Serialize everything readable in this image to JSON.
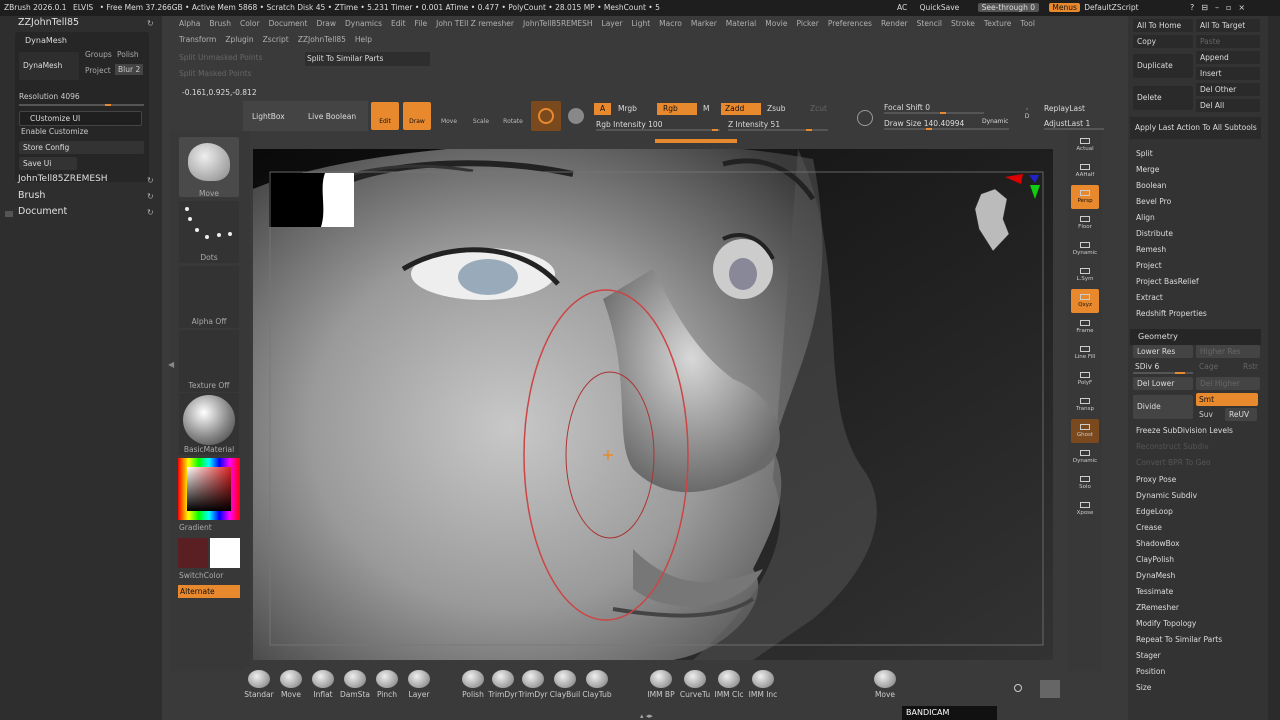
{
  "titlebar": {
    "app": "ZBrush 2026.0.1",
    "user": "ELVIS",
    "stats": "• Free Mem 37.266GB • Active Mem 5868 • Scratch Disk 45 • ZTime • 5.231 Timer • 0.001 ATime • 0.477 • PolyCount • 28.015 MP • MeshCount • 5",
    "ac": "AC",
    "quicksave": "QuickSave",
    "seethrough": "See-through",
    "seethrough_val": "0",
    "menus": "Menus",
    "script": "DefaultZScript"
  },
  "menubar": {
    "row1": [
      "Alpha",
      "Brush",
      "Color",
      "Document",
      "Draw",
      "Dynamics",
      "Edit",
      "File",
      "John TEll Z remesher",
      "JohnTell85REMESH",
      "Layer",
      "Light",
      "Macro",
      "Marker",
      "Material",
      "Movie",
      "Picker",
      "Preferences",
      "Render",
      "Stencil",
      "Stroke",
      "Texture",
      "Tool"
    ],
    "row2": [
      "Transform",
      "Zplugin",
      "Zscript",
      "ZZJohnTell85",
      "Help"
    ]
  },
  "left_panel": {
    "title": "ZZJohnTell85",
    "dynamesh_header": "DynaMesh",
    "dynamesh": "DynaMesh",
    "groups": "Groups",
    "polish": "Polish",
    "project": "Project",
    "blur": "Blur 2",
    "resolution": "Resolution 4096",
    "customize_ui": "CUstomize UI",
    "enable_customize": "Enable Customize",
    "store_config": "Store Config",
    "save_ui": "Save Ui",
    "menu_items": [
      "JohnTell85ZREMESH",
      "Brush",
      "Document"
    ]
  },
  "toolbar": {
    "split_unmasked": "Split Unmasked Points",
    "split_masked": "Split Masked Points",
    "split_similar": "Split To Similar Parts",
    "coords": "-0.161,0.925,-0.812",
    "lightbox": "LightBox",
    "live_boolean": "Live Boolean",
    "edit": "Edit",
    "draw": "Draw",
    "move": "Move",
    "scale": "Scale",
    "rotate": "Rotate",
    "a": "A",
    "mrgb": "Mrgb",
    "rgb": "Rgb",
    "m": "M",
    "zadd": "Zadd",
    "zsub": "Zsub",
    "zcut": "Zcut",
    "rgb_intensity": "Rgb Intensity 100",
    "z_intensity": "Z Intensity 51",
    "focal_shift": "Focal Shift 0",
    "draw_size": "Draw Size 140.40994",
    "dynamic": "Dynamic",
    "replay_last": "ReplayLast",
    "adjust_last": "AdjustLast 1"
  },
  "left_shelf": [
    {
      "label": "Move"
    },
    {
      "label": "Dots"
    },
    {
      "label": "Alpha Off"
    },
    {
      "label": "Texture Off"
    },
    {
      "label": "BasicMaterial"
    },
    {
      "label": "Gradient"
    },
    {
      "label": "SwitchColor"
    },
    {
      "label": "Alternate"
    }
  ],
  "right_shelf": [
    "Actual",
    "AAHalf",
    "Persp",
    "Floor",
    "Dynamic",
    "L.Sym",
    "Qxyz",
    "Frame",
    "Line Fill",
    "PolyF",
    "Transp",
    "Ghost",
    "Dynamic",
    "Solo",
    "Xpose"
  ],
  "right_panel": {
    "all_to_home": "All To Home",
    "all_to_target": "All To Target",
    "copy": "Copy",
    "paste": "Paste",
    "duplicate": "Duplicate",
    "append": "Append",
    "insert": "Insert",
    "delete": "Delete",
    "del_other": "Del Other",
    "del_all": "Del All",
    "apply_last": "Apply Last Action To All Subtools",
    "subtool_actions": [
      "Split",
      "Merge",
      "Boolean",
      "Bevel Pro",
      "Align",
      "Distribute",
      "Remesh",
      "Project",
      "Project BasRelief",
      "Extract",
      "Redshift Properties"
    ],
    "geometry_header": "Geometry",
    "lower_res": "Lower Res",
    "higher_res": "Higher Res",
    "sdiv": "SDiv 6",
    "cage": "Cage",
    "rstr": "Rstr",
    "del_lower": "Del Lower",
    "del_higher": "Del Higher",
    "divide": "Divide",
    "smt": "Smt",
    "suv": "Suv",
    "reuv": "ReUV",
    "freeze": "Freeze SubDivision Levels",
    "reconstruct": "Reconstruct Subdiv",
    "convert_bpr": "Convert BPR To Geo",
    "geometry_items": [
      "Proxy Pose",
      "Dynamic Subdiv",
      "EdgeLoop",
      "Crease",
      "ShadowBox",
      "ClayPolish",
      "DynaMesh",
      "Tessimate",
      "ZRemesher",
      "Modify Topology",
      "Repeat To Similar Parts",
      "Stager",
      "Position",
      "Size"
    ]
  },
  "bottom_shelf": [
    "Standar",
    "Move",
    "Inflat",
    "DamSta",
    "Pinch",
    "Layer",
    "Polish",
    "TrimDyr",
    "TrimDyr",
    "ClayBuil",
    "ClayTub",
    "IMM BP",
    "CurveTu",
    "IMM Clc",
    "IMM Inc",
    "Move"
  ],
  "watermark": "BANDICAM",
  "colors": {
    "accent": "#e8892e",
    "panel": "#333333",
    "background": "#3a3a3a"
  }
}
